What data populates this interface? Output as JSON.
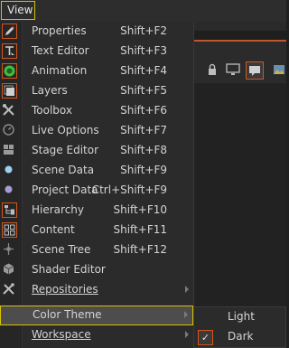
{
  "menubar": {
    "view_label": "View"
  },
  "menu": {
    "items": [
      {
        "label": "Properties",
        "shortcut": "Shift+F2",
        "icon": "pencil-icon"
      },
      {
        "label": "Text Editor",
        "shortcut": "Shift+F3",
        "icon": "text-cursor-icon"
      },
      {
        "label": "Animation",
        "shortcut": "Shift+F4",
        "icon": "animation-circle-icon"
      },
      {
        "label": "Layers",
        "shortcut": "Shift+F5",
        "icon": "layers-icon"
      },
      {
        "label": "Toolbox",
        "shortcut": "Shift+F6",
        "icon": "wrench-screwdriver-icon"
      },
      {
        "label": "Live Options",
        "shortcut": "Shift+F7",
        "icon": "clock-icon"
      },
      {
        "label": "Stage Editor",
        "shortcut": "Shift+F8",
        "icon": "stage-grid-icon"
      },
      {
        "label": "Scene Data",
        "shortcut": "Shift+F9",
        "icon": "blue-dot-icon"
      },
      {
        "label": "Project Data",
        "shortcut": "Ctrl+Shift+F9",
        "icon": "purple-dot-icon"
      },
      {
        "label": "Hierarchy",
        "shortcut": "Shift+F10",
        "icon": "hierarchy-icon"
      },
      {
        "label": "Content",
        "shortcut": "Shift+F11",
        "icon": "content-grid-icon"
      },
      {
        "label": "Scene Tree",
        "shortcut": "Shift+F12",
        "icon": "scene-tree-icon"
      },
      {
        "label": "Shader Editor",
        "shortcut": "",
        "icon": "cube-icon"
      },
      {
        "label": "Repositories",
        "shortcut": "",
        "icon": "tools-icon"
      },
      {
        "label": "Color Theme",
        "shortcut": "",
        "icon": ""
      },
      {
        "label": "Workspace",
        "shortcut": "",
        "icon": ""
      }
    ]
  },
  "submenu": {
    "items": [
      {
        "label": "Light"
      },
      {
        "label": "Dark",
        "checked": true
      }
    ]
  },
  "colors": {
    "highlight_border": "#d8c200",
    "icon_highlight": "#d4541c",
    "accent_orange": "#c0562b"
  }
}
